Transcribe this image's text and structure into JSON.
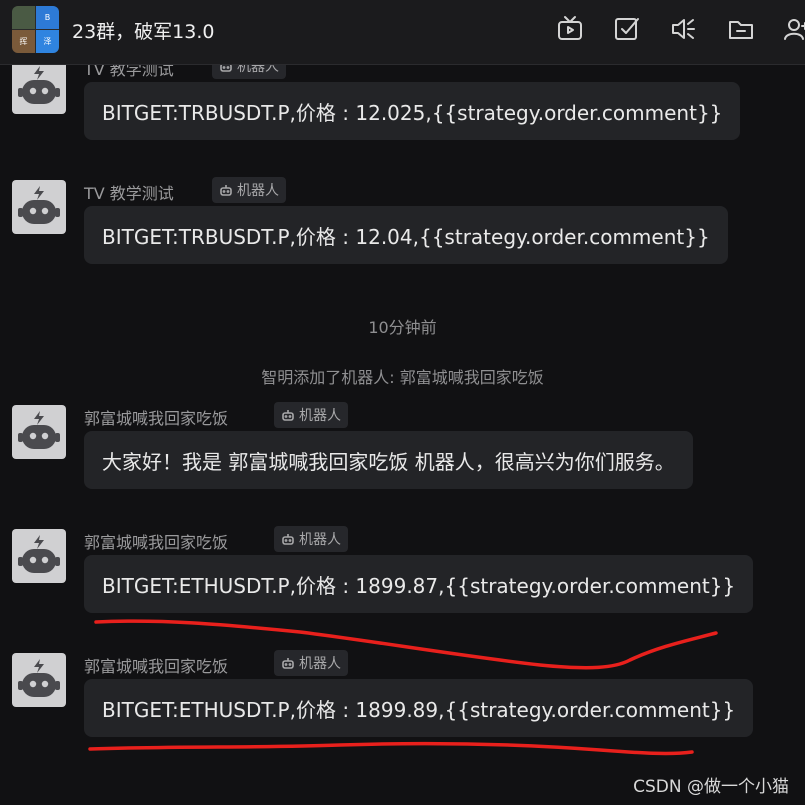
{
  "header": {
    "title": "23群，破军13.0",
    "avatar_cells": [
      "",
      "B",
      "挥",
      "泽"
    ]
  },
  "messages": [
    {
      "sender": "TV 教学测试",
      "badge": "机器人",
      "text": "BITGET:TRBUSDT.P,价格 : 12.025,{{strategy.order.comment}}"
    },
    {
      "sender": "TV 教学测试",
      "badge": "机器人",
      "text": "BITGET:TRBUSDT.P,价格 : 12.04,{{strategy.order.comment}}"
    },
    {
      "sender": "郭富城喊我回家吃饭",
      "badge": "机器人",
      "text": "大家好！我是 郭富城喊我回家吃饭 机器人，很高兴为你们服务。"
    },
    {
      "sender": "郭富城喊我回家吃饭",
      "badge": "机器人",
      "text": "BITGET:ETHUSDT.P,价格 : 1899.87,{{strategy.order.comment}}"
    },
    {
      "sender": "郭富城喊我回家吃饭",
      "badge": "机器人",
      "text": "BITGET:ETHUSDT.P,价格 : 1899.89,{{strategy.order.comment}}"
    }
  ],
  "system": {
    "time": "10分钟前",
    "notice": "智明添加了机器人: 郭富城喊我回家吃饭"
  },
  "watermark": "CSDN @做一个小猫",
  "annotation_color": "#e8201c",
  "icons": [
    "tv-icon",
    "checkbox-icon",
    "speaker-icon",
    "folder-icon",
    "add-user-icon",
    "robot-icon"
  ]
}
